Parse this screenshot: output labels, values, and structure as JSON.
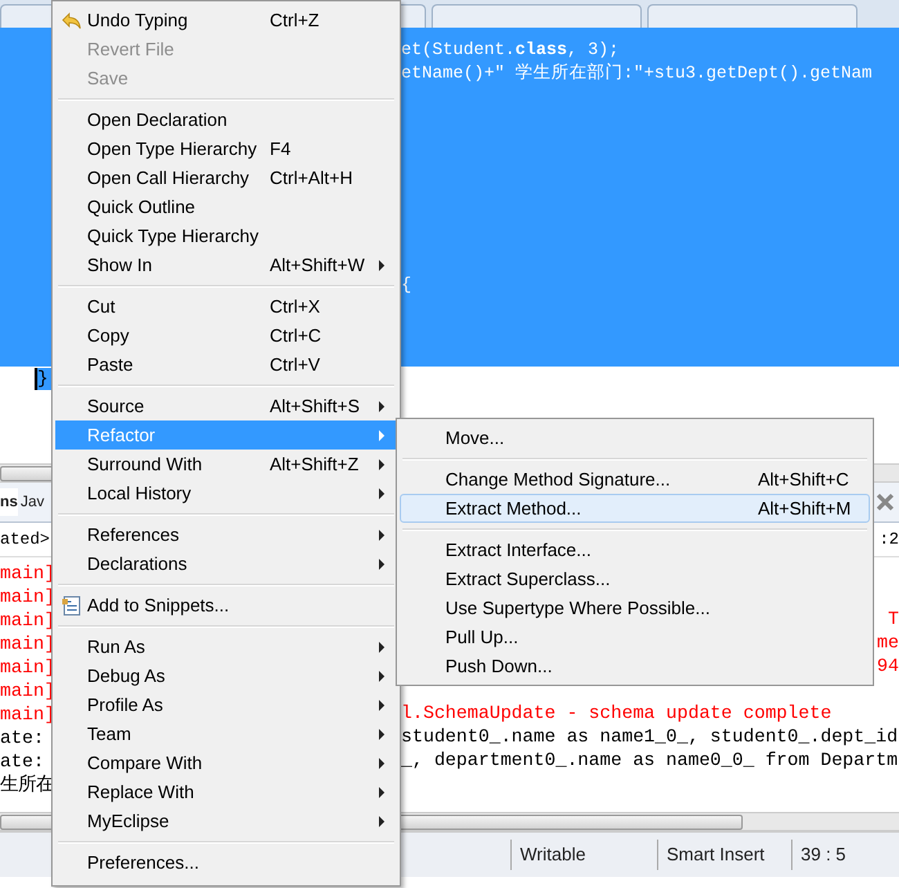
{
  "editor": {
    "code_lines": [
      "et(Student.**class**, 3);",
      "etName()+\" 学生所在部门:\"+stu3.getDept().getNam"
    ],
    "block_line": "{",
    "cursor_line": "}"
  },
  "console": {
    "tabs": [
      {
        "label": "ns",
        "selected": true
      },
      {
        "label": "Jav",
        "selected": false
      }
    ],
    "header_left": "ated>",
    "header_right": ":2",
    "lines": [
      {
        "kind": "error",
        "left": "main]"
      },
      {
        "kind": "error",
        "left": "main]"
      },
      {
        "kind": "error",
        "left": "main]",
        "right_tail": "T"
      },
      {
        "kind": "error",
        "left": "main]",
        "right_tail": "me"
      },
      {
        "kind": "error",
        "left": "main]",
        "right_tail": "94"
      },
      {
        "kind": "error",
        "left": "main]"
      },
      {
        "kind": "error",
        "left": "main]",
        "right": "l.SchemaUpdate - schema update complete"
      },
      {
        "kind": "info",
        "left": "ate:",
        "right": "student0_.name as name1_0_, student0_.dept_id"
      },
      {
        "kind": "info",
        "left": "ate:",
        "right": "_, department0_.name as name0_0_ from Departm"
      },
      {
        "kind": "info",
        "left": "生所在"
      }
    ]
  },
  "status_bar": [
    "Writable",
    "Smart Insert",
    "39 : 5"
  ],
  "context_menu": {
    "groups": [
      [
        {
          "kind": "undo",
          "label": "Undo Typing",
          "shortcut": "Ctrl+Z",
          "submenu": false,
          "disabled": false,
          "selected": false
        },
        {
          "kind": "plain",
          "label": "Revert File",
          "submenu": false,
          "disabled": true,
          "selected": false
        },
        {
          "kind": "plain",
          "label": "Save",
          "submenu": false,
          "disabled": true,
          "selected": false
        }
      ],
      [
        {
          "kind": "plain",
          "label": "Open Declaration",
          "submenu": false,
          "disabled": false,
          "selected": false
        },
        {
          "kind": "plain",
          "label": "Open Type Hierarchy",
          "shortcut": "F4",
          "submenu": false,
          "disabled": false,
          "selected": false
        },
        {
          "kind": "plain",
          "label": "Open Call Hierarchy",
          "shortcut": "Ctrl+Alt+H",
          "submenu": false,
          "disabled": false,
          "selected": false
        },
        {
          "kind": "plain",
          "label": "Quick Outline",
          "submenu": false,
          "disabled": false,
          "selected": false
        },
        {
          "kind": "plain",
          "label": "Quick Type Hierarchy",
          "submenu": false,
          "disabled": false,
          "selected": false
        },
        {
          "kind": "plain",
          "label": "Show In",
          "shortcut": "Alt+Shift+W",
          "submenu": true,
          "disabled": false,
          "selected": false
        }
      ],
      [
        {
          "kind": "plain",
          "label": "Cut",
          "shortcut": "Ctrl+X",
          "submenu": false,
          "disabled": false,
          "selected": false
        },
        {
          "kind": "plain",
          "label": "Copy",
          "shortcut": "Ctrl+C",
          "submenu": false,
          "disabled": false,
          "selected": false
        },
        {
          "kind": "plain",
          "label": "Paste",
          "shortcut": "Ctrl+V",
          "submenu": false,
          "disabled": false,
          "selected": false
        }
      ],
      [
        {
          "kind": "plain",
          "label": "Source",
          "shortcut": "Alt+Shift+S",
          "submenu": true,
          "disabled": false,
          "selected": false
        },
        {
          "kind": "plain",
          "label": "Refactor",
          "submenu": true,
          "disabled": false,
          "selected": true
        },
        {
          "kind": "plain",
          "label": "Surround With",
          "shortcut": "Alt+Shift+Z",
          "submenu": true,
          "disabled": false,
          "selected": false
        },
        {
          "kind": "plain",
          "label": "Local History",
          "submenu": true,
          "disabled": false,
          "selected": false
        }
      ],
      [
        {
          "kind": "plain",
          "label": "References",
          "submenu": true,
          "disabled": false,
          "selected": false
        },
        {
          "kind": "plain",
          "label": "Declarations",
          "submenu": true,
          "disabled": false,
          "selected": false
        }
      ],
      [
        {
          "kind": "snippets",
          "label": "Add to Snippets...",
          "submenu": false,
          "disabled": false,
          "selected": false
        }
      ],
      [
        {
          "kind": "plain",
          "label": "Run As",
          "submenu": true,
          "disabled": false,
          "selected": false
        },
        {
          "kind": "plain",
          "label": "Debug As",
          "submenu": true,
          "disabled": false,
          "selected": false
        },
        {
          "kind": "plain",
          "label": "Profile As",
          "submenu": true,
          "disabled": false,
          "selected": false
        },
        {
          "kind": "plain",
          "label": "Team",
          "submenu": true,
          "disabled": false,
          "selected": false
        },
        {
          "kind": "plain",
          "label": "Compare With",
          "submenu": true,
          "disabled": false,
          "selected": false
        },
        {
          "kind": "plain",
          "label": "Replace With",
          "submenu": true,
          "disabled": false,
          "selected": false
        },
        {
          "kind": "plain",
          "label": "MyEclipse",
          "submenu": true,
          "disabled": false,
          "selected": false
        }
      ],
      [
        {
          "kind": "plain",
          "label": "Preferences...",
          "submenu": false,
          "disabled": false,
          "selected": false
        }
      ]
    ]
  },
  "refactor_submenu": {
    "groups": [
      [
        {
          "label": "Move...",
          "selected": false
        }
      ],
      [
        {
          "label": "Change Method Signature...",
          "shortcut": "Alt+Shift+C",
          "selected": false
        },
        {
          "label": "Extract Method...",
          "shortcut": "Alt+Shift+M",
          "selected": true
        }
      ],
      [
        {
          "label": "Extract Interface...",
          "selected": false
        },
        {
          "label": "Extract Superclass...",
          "selected": false
        },
        {
          "label": "Use Supertype Where Possible...",
          "selected": false
        },
        {
          "label": "Pull Up...",
          "selected": false
        },
        {
          "label": "Push Down...",
          "selected": false
        }
      ]
    ]
  }
}
